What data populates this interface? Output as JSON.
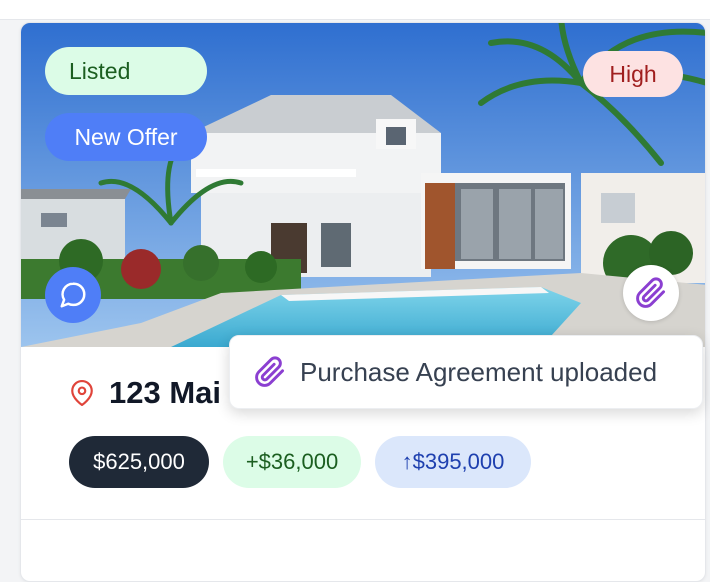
{
  "card": {
    "status_badge": "Listed",
    "offer_badge": "New Offer",
    "priority_badge": "High",
    "address": "123 Mai",
    "price": "$625,000",
    "gain": "+$36,000",
    "appreciation": "↑$395,000"
  },
  "toast": {
    "message": "Purchase Agreement uploaded"
  },
  "icons": {
    "chat": "chat-bubble-icon",
    "attachment": "paperclip-icon",
    "location": "map-pin-icon"
  },
  "colors": {
    "accent_blue": "#4f7ef7",
    "listed_bg": "#dcfce7",
    "high_bg": "#fde2e2",
    "price_bg": "#1f2937",
    "attachment_purple": "#8b3fd1"
  }
}
